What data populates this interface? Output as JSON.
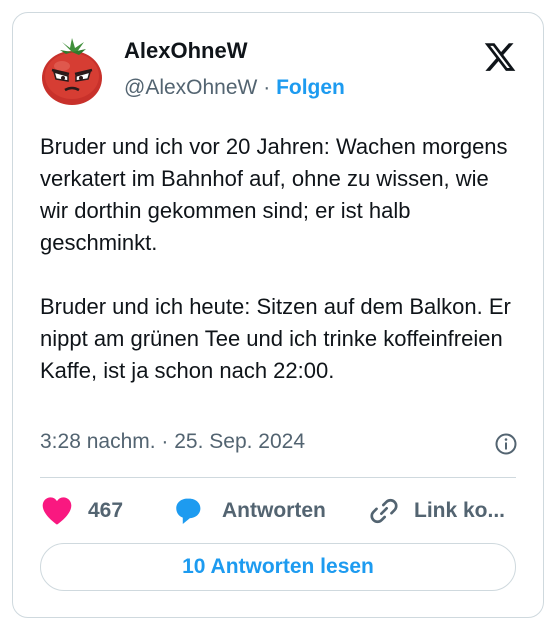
{
  "author": {
    "name": "AlexOhneW",
    "handle": "@AlexOhneW",
    "separator": "·",
    "follow_label": "Folgen",
    "avatar_icon": "angry-tomato-avatar"
  },
  "platform_icon": "x-logo-icon",
  "tweet": {
    "paragraph_1": "Bruder und ich vor 20 Jahren: Wachen morgens verkatert im Bahnhof auf, ohne zu wissen, wie wir dorthin gekommen sind; er ist halb geschminkt.",
    "paragraph_2": "Bruder und ich heute: Sitzen auf dem Balkon. Er nippt am grünen Tee und ich trinke koffeinfreien Kaffe, ist ja schon nach 22:00.",
    "timestamp": "3:28 nachm. · 25. Sep. 2024"
  },
  "actions": {
    "like_count": "467",
    "reply_label": "Antworten",
    "copy_link_label": "Link ko..."
  },
  "read_replies_label": "10 Antworten lesen",
  "colors": {
    "accent": "#1d9bf0",
    "like": "#f91880",
    "text": "#0f1419",
    "secondary": "#536471",
    "border": "#cfd9de"
  }
}
